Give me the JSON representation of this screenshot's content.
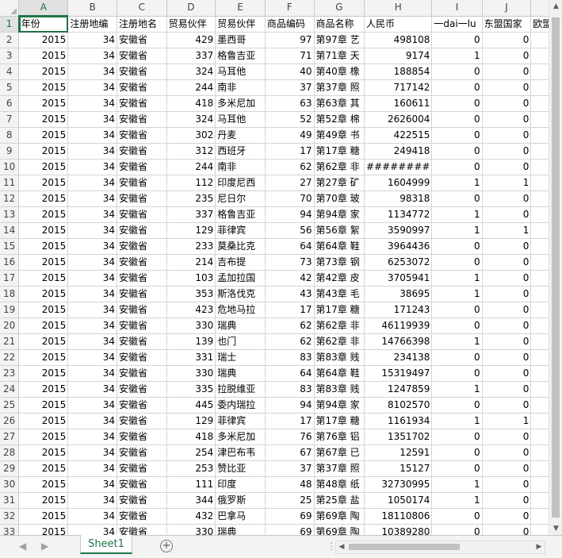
{
  "columns": [
    "A",
    "B",
    "C",
    "D",
    "E",
    "F",
    "G",
    "H",
    "I",
    "J",
    ""
  ],
  "selected_cell": "A1",
  "header_row": [
    "年份",
    "注册地编",
    "注册地名",
    "贸易伙伴",
    "贸易伙伴",
    "商品编码",
    "商品名称",
    "人民币",
    "一dai一lu",
    "东盟国家",
    "欧盟"
  ],
  "rows": [
    [
      "2015",
      "34",
      "安徽省",
      "429",
      "墨西哥",
      "97",
      "第97章 艺",
      "498108",
      "0",
      "0"
    ],
    [
      "2015",
      "34",
      "安徽省",
      "337",
      "格鲁吉亚",
      "71",
      "第71章 天",
      "9174",
      "1",
      "0"
    ],
    [
      "2015",
      "34",
      "安徽省",
      "324",
      "马耳他",
      "40",
      "第40章 橡",
      "188854",
      "0",
      "0"
    ],
    [
      "2015",
      "34",
      "安徽省",
      "244",
      "南非",
      "37",
      "第37章 照",
      "717142",
      "0",
      "0"
    ],
    [
      "2015",
      "34",
      "安徽省",
      "418",
      "多米尼加",
      "63",
      "第63章 其",
      "160611",
      "0",
      "0"
    ],
    [
      "2015",
      "34",
      "安徽省",
      "324",
      "马耳他",
      "52",
      "第52章 棉",
      "2626004",
      "0",
      "0"
    ],
    [
      "2015",
      "34",
      "安徽省",
      "302",
      "丹麦",
      "49",
      "第49章 书",
      "422515",
      "0",
      "0"
    ],
    [
      "2015",
      "34",
      "安徽省",
      "312",
      "西班牙",
      "17",
      "第17章 糖",
      "249418",
      "0",
      "0"
    ],
    [
      "2015",
      "34",
      "安徽省",
      "244",
      "南非",
      "62",
      "第62章 非",
      "########",
      "0",
      "0"
    ],
    [
      "2015",
      "34",
      "安徽省",
      "112",
      "印度尼西",
      "27",
      "第27章 矿",
      "1604999",
      "1",
      "1"
    ],
    [
      "2015",
      "34",
      "安徽省",
      "235",
      "尼日尔",
      "70",
      "第70章 玻",
      "98318",
      "0",
      "0"
    ],
    [
      "2015",
      "34",
      "安徽省",
      "337",
      "格鲁吉亚",
      "94",
      "第94章 家",
      "1134772",
      "1",
      "0"
    ],
    [
      "2015",
      "34",
      "安徽省",
      "129",
      "菲律宾",
      "56",
      "第56章 絮",
      "3590997",
      "1",
      "1"
    ],
    [
      "2015",
      "34",
      "安徽省",
      "233",
      "莫桑比克",
      "64",
      "第64章 鞋",
      "3964436",
      "0",
      "0"
    ],
    [
      "2015",
      "34",
      "安徽省",
      "214",
      "吉布提",
      "73",
      "第73章 钢",
      "6253072",
      "0",
      "0"
    ],
    [
      "2015",
      "34",
      "安徽省",
      "103",
      "孟加拉国",
      "42",
      "第42章 皮",
      "3705941",
      "1",
      "0"
    ],
    [
      "2015",
      "34",
      "安徽省",
      "353",
      "斯洛伐克",
      "43",
      "第43章 毛",
      "38695",
      "1",
      "0"
    ],
    [
      "2015",
      "34",
      "安徽省",
      "423",
      "危地马拉",
      "17",
      "第17章 糖",
      "171243",
      "0",
      "0"
    ],
    [
      "2015",
      "34",
      "安徽省",
      "330",
      "瑞典",
      "62",
      "第62章 非",
      "46119939",
      "0",
      "0"
    ],
    [
      "2015",
      "34",
      "安徽省",
      "139",
      "也门",
      "62",
      "第62章 非",
      "14766398",
      "1",
      "0"
    ],
    [
      "2015",
      "34",
      "安徽省",
      "331",
      "瑞士",
      "83",
      "第83章 贱",
      "234138",
      "0",
      "0"
    ],
    [
      "2015",
      "34",
      "安徽省",
      "330",
      "瑞典",
      "64",
      "第64章 鞋",
      "15319497",
      "0",
      "0"
    ],
    [
      "2015",
      "34",
      "安徽省",
      "335",
      "拉脱维亚",
      "83",
      "第83章 贱",
      "1247859",
      "1",
      "0"
    ],
    [
      "2015",
      "34",
      "安徽省",
      "445",
      "委内瑞拉",
      "94",
      "第94章 家",
      "8102570",
      "0",
      "0"
    ],
    [
      "2015",
      "34",
      "安徽省",
      "129",
      "菲律宾",
      "17",
      "第17章 糖",
      "1161934",
      "1",
      "1"
    ],
    [
      "2015",
      "34",
      "安徽省",
      "418",
      "多米尼加",
      "76",
      "第76章 铝",
      "1351702",
      "0",
      "0"
    ],
    [
      "2015",
      "34",
      "安徽省",
      "254",
      "津巴布韦",
      "67",
      "第67章 已",
      "12591",
      "0",
      "0"
    ],
    [
      "2015",
      "34",
      "安徽省",
      "253",
      "赞比亚",
      "37",
      "第37章 照",
      "15127",
      "0",
      "0"
    ],
    [
      "2015",
      "34",
      "安徽省",
      "111",
      "印度",
      "48",
      "第48章 纸",
      "32730995",
      "1",
      "0"
    ],
    [
      "2015",
      "34",
      "安徽省",
      "344",
      "俄罗斯",
      "25",
      "第25章 盐",
      "1050174",
      "1",
      "0"
    ],
    [
      "2015",
      "34",
      "安徽省",
      "432",
      "巴拿马",
      "69",
      "第69章 陶",
      "18110806",
      "0",
      "0"
    ],
    [
      "2015",
      "34",
      "安徽省",
      "330",
      "瑞典",
      "69",
      "第69章 陶",
      "10389280",
      "0",
      "0"
    ]
  ],
  "sheet_tab": "Sheet1",
  "icons": {
    "add_sheet": "plus-circle-icon",
    "nav_prev": "triangle-left-icon",
    "nav_next": "triangle-right-icon",
    "scroll_up": "triangle-up-icon",
    "scroll_down": "triangle-down-icon",
    "scroll_left": "triangle-left-icon",
    "scroll_right": "triangle-right-icon"
  },
  "colors": {
    "accent": "#217346",
    "header_bg": "#f3f3f3",
    "gridline": "#d4d4d4"
  }
}
